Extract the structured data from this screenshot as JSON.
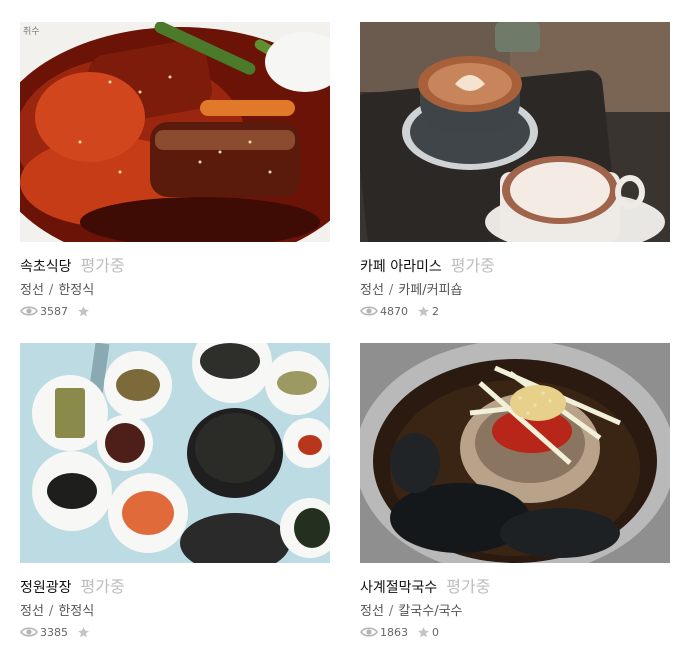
{
  "items": [
    {
      "name": "속초식당",
      "rating_status": "평가중",
      "region": "정선",
      "category": "한정식",
      "views": "3587",
      "stars": "",
      "watermark": "취수"
    },
    {
      "name": "카페 아라미스",
      "rating_status": "평가중",
      "region": "정선",
      "category": "카페/커피숍",
      "views": "4870",
      "stars": "2"
    },
    {
      "name": "정원광장",
      "rating_status": "평가중",
      "region": "정선",
      "category": "한정식",
      "views": "3385",
      "stars": ""
    },
    {
      "name": "사계절막국수",
      "rating_status": "평가중",
      "region": "정선",
      "category": "칼국수/국수",
      "views": "1863",
      "stars": "0"
    }
  ],
  "separator": "/",
  "icons": {
    "views": "eye-icon",
    "stars": "star-icon"
  },
  "colors": {
    "rating_status": "#bdbdbd",
    "icon": "#b5b5b5"
  }
}
